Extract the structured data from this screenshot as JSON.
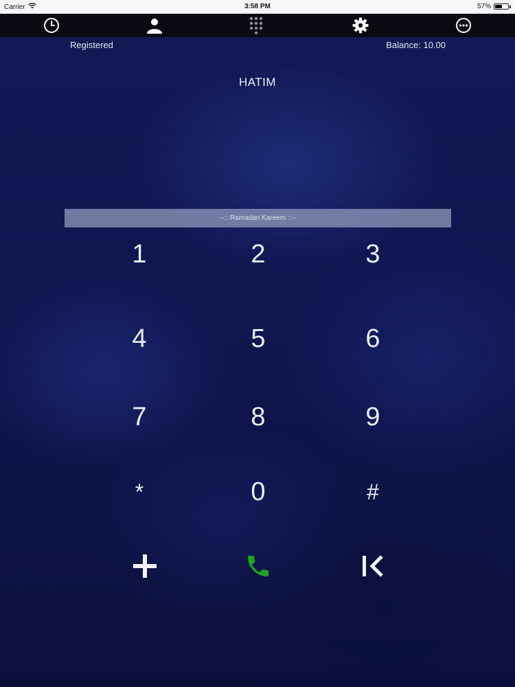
{
  "status_bar": {
    "carrier": "Carrier",
    "time": "3:58 PM",
    "battery": "57%",
    "battery_level": 0.57
  },
  "nav": {
    "items": [
      {
        "name": "recents",
        "icon": "clock-icon"
      },
      {
        "name": "contacts",
        "icon": "person-icon"
      },
      {
        "name": "keypad",
        "icon": "keypad-grid-icon"
      },
      {
        "name": "settings",
        "icon": "gear-icon"
      },
      {
        "name": "more",
        "icon": "more-dots-icon"
      }
    ]
  },
  "account": {
    "status": "Registered",
    "balance": "Balance: 10.00",
    "user": "HATIM"
  },
  "dial_field": {
    "placeholder": "--:: Ramadan Kareem ::--",
    "value": ""
  },
  "keypad": {
    "keys": [
      "1",
      "2",
      "3",
      "4",
      "5",
      "6",
      "7",
      "8",
      "9",
      "*",
      "0",
      "#"
    ]
  },
  "actions": {
    "add_icon": "plus-icon",
    "call_icon": "phone-icon",
    "call_color": "#19a81c",
    "delete_icon": "backspace-icon"
  },
  "colors": {
    "background": "#101650",
    "navbar": "#0a0b12",
    "text": "#e9ecf6"
  }
}
